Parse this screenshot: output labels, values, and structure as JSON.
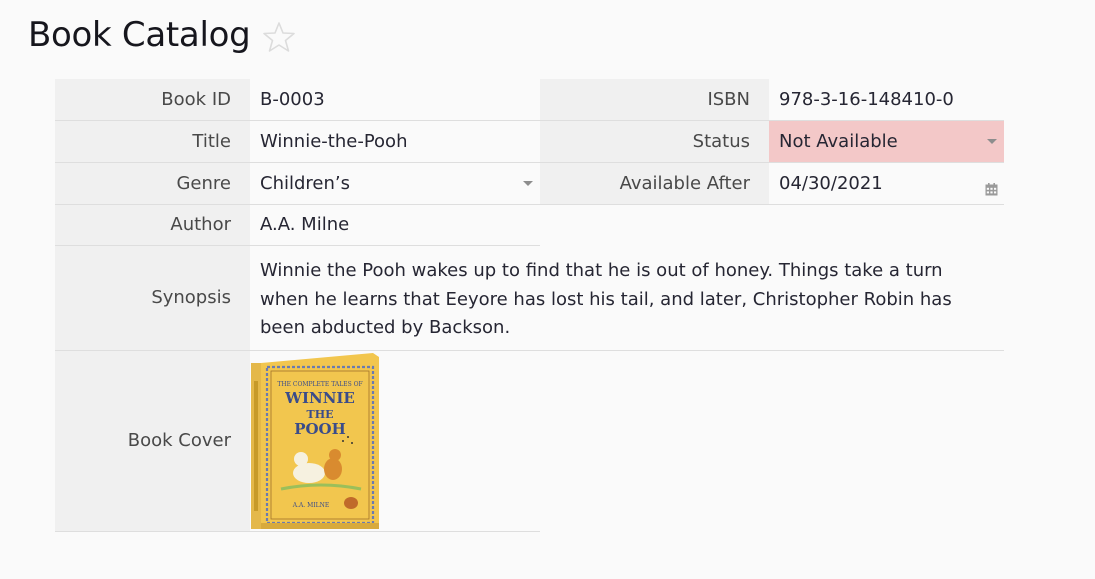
{
  "header": {
    "title": "Book Catalog"
  },
  "fields": {
    "book_id": {
      "label": "Book ID",
      "value": "B-0003"
    },
    "isbn": {
      "label": "ISBN",
      "value": "978-3-16-148410-0"
    },
    "title": {
      "label": "Title",
      "value": "Winnie-the-Pooh"
    },
    "status": {
      "label": "Status",
      "value": "Not Available",
      "color": "#f3c8c8"
    },
    "genre": {
      "label": "Genre",
      "value": "Children’s"
    },
    "available_after": {
      "label": "Available After",
      "value": "04/30/2021"
    },
    "author": {
      "label": "Author",
      "value": "A.A. Milne"
    },
    "synopsis": {
      "label": "Synopsis",
      "value": "Winnie the Pooh wakes up to find that he is out of honey. Things take a turn when he learns that Eeyore has lost his tail, and later, Christopher Robin has been abducted by Backson."
    },
    "book_cover": {
      "label": "Book Cover",
      "cover_text": {
        "top": "THE COMPLETE TALES OF",
        "line1": "WINNIE",
        "line2": "THE",
        "line3": "POOH",
        "author": "A.A. MILNE"
      }
    }
  },
  "icons": {
    "favorite": "star-outline-icon",
    "dropdown": "chevron-down-icon",
    "calendar": "calendar-icon"
  }
}
